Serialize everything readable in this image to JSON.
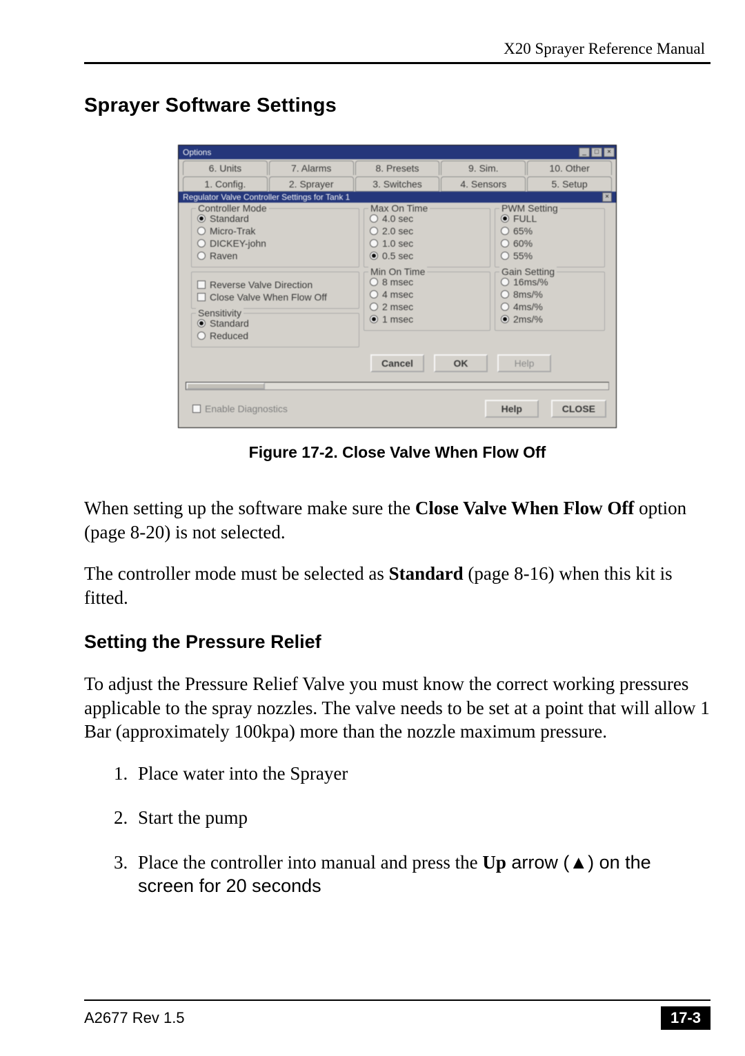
{
  "header": {
    "title": "X20 Sprayer Reference Manual"
  },
  "section": {
    "title": "Sprayer Software Settings",
    "subsection_title": "Setting the Pressure Relief"
  },
  "figure": {
    "caption": "Figure 17-2. Close Valve When Flow Off",
    "window_title": "Options",
    "tabs_row1": [
      "6. Units",
      "7. Alarms",
      "8. Presets",
      "9. Sim.",
      "10. Other"
    ],
    "tabs_row2": [
      "1. Config.",
      "2. Sprayer",
      "3. Switches",
      "4. Sensors",
      "5. Setup"
    ],
    "sub_titlebar": "Regulator Valve Controller Settings for Tank 1",
    "controller_mode": {
      "legend": "Controller Mode",
      "options": [
        "Standard",
        "Micro-Trak",
        "DICKEY-john",
        "Raven"
      ],
      "selected": "Standard"
    },
    "checkboxes": {
      "reverse": "Reverse Valve Direction",
      "close_flow_off": "Close Valve When Flow Off"
    },
    "sensitivity": {
      "legend": "Sensitivity",
      "options": [
        "Standard",
        "Reduced"
      ],
      "selected": "Standard"
    },
    "max_on_time": {
      "legend": "Max On Time",
      "options": [
        "4.0 sec",
        "2.0 sec",
        "1.0 sec",
        "0.5 sec"
      ],
      "selected": "0.5 sec"
    },
    "min_on_time": {
      "legend": "Min On Time",
      "options": [
        "8 msec",
        "4 msec",
        "2 msec",
        "1 msec"
      ],
      "selected": "1 msec"
    },
    "pwm_setting": {
      "legend": "PWM Setting",
      "options": [
        "FULL",
        "65%",
        "60%",
        "55%"
      ],
      "selected": "FULL"
    },
    "gain_setting": {
      "legend": "Gain Setting",
      "options": [
        "16ms/%",
        "8ms/%",
        "4ms/%",
        "2ms/%"
      ],
      "selected": "2ms/%"
    },
    "panel_buttons": {
      "cancel": "Cancel",
      "ok": "OK",
      "help": "Help"
    },
    "footer": {
      "enable_diag": "Enable Diagnostics",
      "help": "Help",
      "close": "CLOSE"
    }
  },
  "paragraphs": {
    "p1_a": "When setting up the software make sure the ",
    "p1_b": "Close Valve When Flow Off",
    "p1_c": " option (page 8-20) is not selected.",
    "p2_a": "The controller mode must be selected as ",
    "p2_b": "Standard",
    "p2_c": " (page 8-16) when this kit is fitted.",
    "p3": "To adjust the Pressure Relief Valve you must know the correct working pressures applicable to the spray nozzles. The valve needs to be set at a point that will allow 1 Bar (approximately 100kpa) more than the nozzle maximum pressure."
  },
  "steps": {
    "s1": "Place water into the Sprayer",
    "s2": "Start the pump",
    "s3_a": "Place the controller into manual and press the ",
    "s3_b": "Up",
    "s3_c": " arrow (▲) on the screen for 20 seconds"
  },
  "footer": {
    "left": "A2677 Rev 1.5",
    "right": "17-3"
  }
}
